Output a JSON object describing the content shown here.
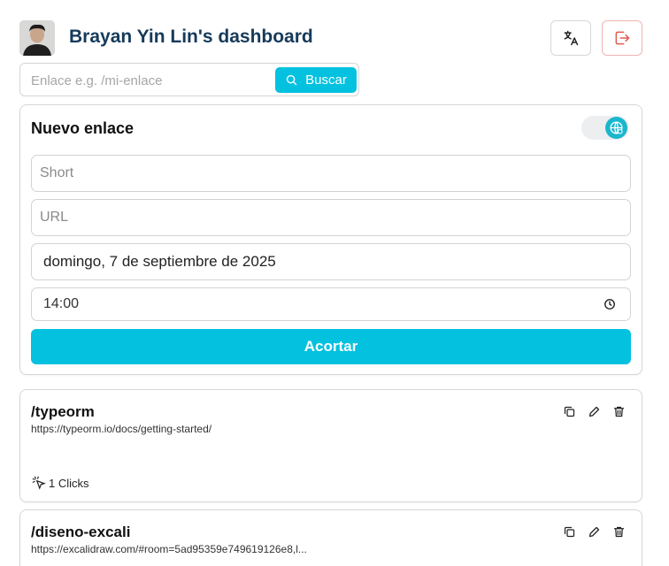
{
  "header": {
    "title": "Brayan Yin Lin's dashboard",
    "translate_icon": "translate-icon",
    "logout_icon": "logout-icon"
  },
  "search": {
    "placeholder": "Enlace e.g. /mi-enlace",
    "button_label": "Buscar",
    "icon": "search-icon"
  },
  "new_link_form": {
    "title": "Nuevo enlace",
    "toggle_icon": "globe-icon",
    "short_placeholder": "Short",
    "url_placeholder": "URL",
    "date_value": "domingo, 7 de septiembre de 2025",
    "time_value": "14:00",
    "submit_label": "Acortar"
  },
  "links": [
    {
      "short": "/typeorm",
      "url": "https://typeorm.io/docs/getting-started/",
      "clicks_label": "1 Clicks"
    },
    {
      "short": "/diseno-excali",
      "url": "https://excalidraw.com/#room=5ad95359e749619126e8,l..."
    }
  ],
  "colors": {
    "accent": "#04c1e0",
    "title": "#163a5a",
    "danger": "#e05a4f"
  }
}
